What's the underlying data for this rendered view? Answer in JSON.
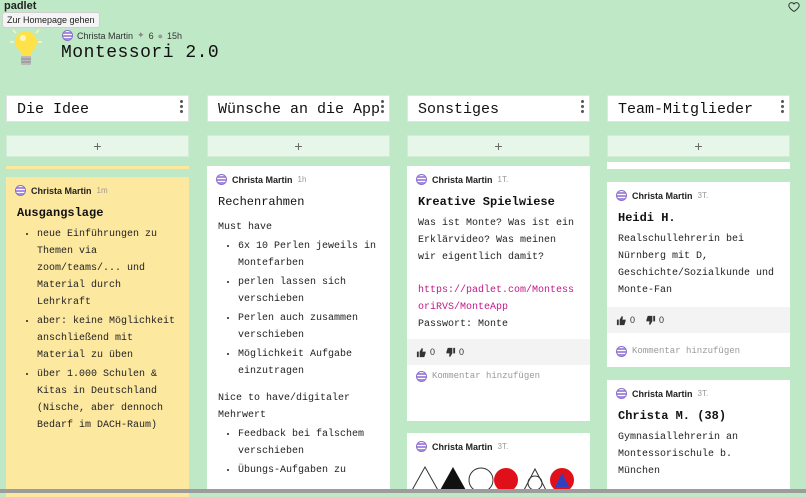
{
  "app": {
    "brand": "padlet",
    "tooltip": "Zur Homepage gehen"
  },
  "header": {
    "author": "Christa Martin",
    "likes": "6",
    "age": "15h",
    "title": "Montessori 2.0"
  },
  "columns": [
    {
      "title": "Die Idee",
      "add": "+",
      "cards": [
        {
          "author": "Christa Martin",
          "time": "1m",
          "title": "Ausgangslage",
          "bullets": [
            "neue Einführungen zu Themen via zoom/teams/... und Material durch Lehrkraft",
            "aber: keine Möglichkeit anschließend mit Material zu üben",
            "über 1.000 Schulen & Kitas in Deutschland (Nische, aber dennoch Bedarf im DACH-Raum)"
          ]
        }
      ]
    },
    {
      "title": "Wünsche an die App",
      "add": "+",
      "cards": [
        {
          "author": "Christa Martin",
          "time": "1h",
          "title": "Rechenrahmen",
          "section1": "Must have",
          "bullets1": [
            "6x 10 Perlen jeweils in Montefarben",
            "perlen lassen sich verschieben",
            "Perlen auch zusammen verschieben",
            "Möglichkeit Aufgabe einzutragen"
          ],
          "section2": "Nice to have/digitaler Mehrwert",
          "bullets2": [
            "Feedback bei falschem verschieben",
            "Übungs-Aufgaben zu"
          ]
        }
      ]
    },
    {
      "title": "Sonstiges",
      "add": "+",
      "cards": [
        {
          "author": "Christa Martin",
          "time": "1T.",
          "title": "Kreative Spielwiese",
          "text": "Was ist Monte? Was ist ein Erklärvideo? Was meinen wir eigentlich damit?",
          "link": "https://padlet.com/MontessoriRVS/MonteApp",
          "password": "Passwort: Monte",
          "up": "0",
          "down": "0",
          "comment": "Kommentar hinzufügen"
        },
        {
          "author": "Christa Martin",
          "time": "3T."
        }
      ]
    },
    {
      "title": "Team-Mitglieder",
      "add": "+",
      "cards": [
        {
          "author": "Christa Martin",
          "time": "3T.",
          "title": "Heidi H.",
          "text": "Realschullehrerin bei Nürnberg mit D, Geschichte/Sozialkunde und Monte-Fan",
          "up": "0",
          "down": "0",
          "comment": "Kommentar hinzufügen"
        },
        {
          "author": "Christa Martin",
          "time": "3T.",
          "title": "Christa M. (38)",
          "text": "Gymnasiallehrerin an Montessorischule b. München"
        }
      ]
    }
  ],
  "colors": {
    "background": "#bfe8c7",
    "yellow_card": "#fde8a0",
    "link": "#c2188a"
  },
  "icons": [
    "lightbulb-icon",
    "heart-icon",
    "kebab-menu-icon",
    "thumbs-up-icon",
    "thumbs-down-icon",
    "avatar-icon"
  ]
}
